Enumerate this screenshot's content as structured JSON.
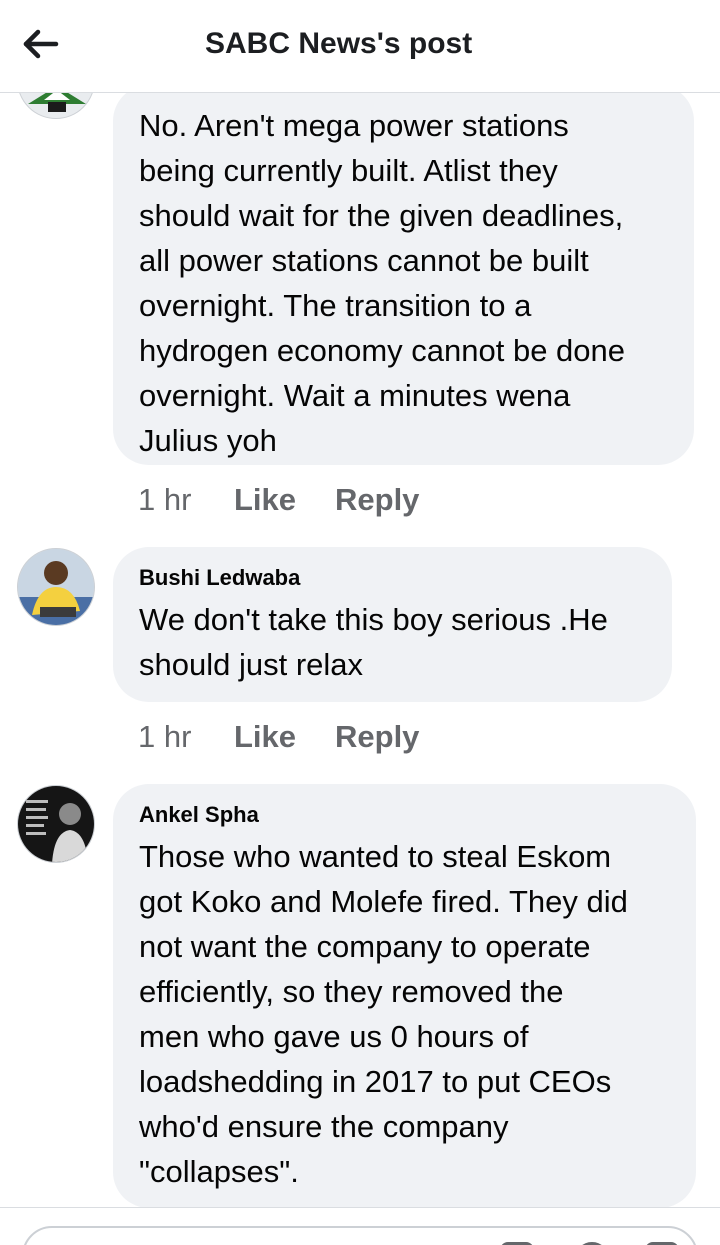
{
  "header": {
    "title": "SABC News's post",
    "back_icon": "arrow-left-icon"
  },
  "comments": [
    {
      "author": "",
      "text": "No. Aren't mega power stations\nbeing currently built. Atlist they\nshould wait for the given deadlines,\nall power stations cannot be built\novernight. The transition to a\nhydrogen economy cannot be done\novernight. Wait a minutes wena\nJulius yoh",
      "time": "1 hr",
      "like_label": "Like",
      "reply_label": "Reply"
    },
    {
      "author": "Bushi Ledwaba",
      "text": "We don't take this boy serious .He\nshould just relax",
      "time": "1 hr",
      "like_label": "Like",
      "reply_label": "Reply"
    },
    {
      "author": "Ankel Spha",
      "text": "Those who wanted to steal Eskom\ngot Koko and Molefe fired. They did\nnot want the company to operate\nefficiently, so they removed the\nmen who gave us 0 hours of\nloadshedding in 2017 to put CEOs\nwho'd ensure the company\n\"collapses\".",
      "time": "",
      "like_label": "",
      "reply_label": ""
    }
  ],
  "composer": {
    "placeholder": ""
  },
  "colors": {
    "bubble_bg": "#f0f2f5",
    "meta_text": "#65676b",
    "primary_text": "#050505",
    "divider": "#dadde1"
  }
}
